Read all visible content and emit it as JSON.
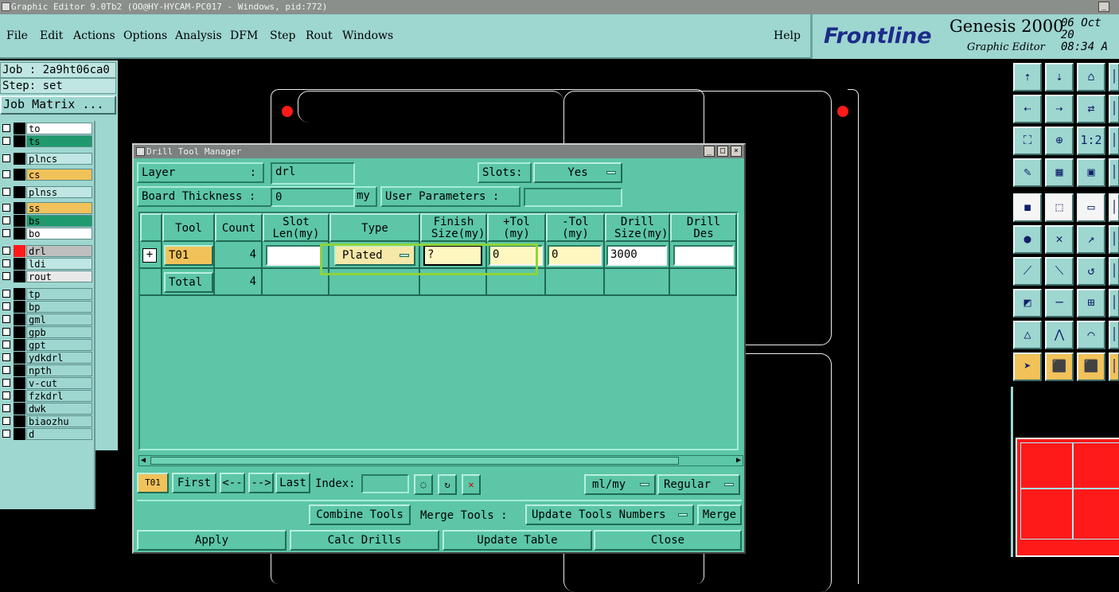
{
  "window": {
    "title": "Graphic Editor 9.0Tb2 (OO@HY-HYCAM-PC017 - Windows, pid:772)",
    "min_label": "_"
  },
  "menu": [
    "File",
    "Edit",
    "Actions",
    "Options",
    "Analysis",
    "DFM",
    "Step",
    "Rout",
    "Windows"
  ],
  "help_label": "Help",
  "brand": {
    "logo": "Frontline",
    "product": "Genesis 2000",
    "subtitle": "Graphic Editor",
    "date": "06 Oct 20",
    "time": "08:34 A"
  },
  "job": {
    "job_text": "Job : 2a9ht06ca0",
    "step_text": "Step: set",
    "matrix_label": "Job Matrix ..."
  },
  "layers": [
    {
      "name": "to",
      "color": "#ffffff"
    },
    {
      "name": "ts",
      "color": "#1f9a6e"
    },
    {
      "name": "plncs",
      "color": "#bfe6e2"
    },
    {
      "name": "cs",
      "color": "#f2c25a"
    },
    {
      "name": "plnss",
      "color": "#bfe6e2"
    },
    {
      "name": "ss",
      "color": "#f2c25a"
    },
    {
      "name": "bs",
      "color": "#1f9a6e"
    },
    {
      "name": "bo",
      "color": "#ffffff"
    },
    {
      "name": "drl",
      "color": "#bfbfbf"
    },
    {
      "name": "ldi",
      "color": "#bfe6e2"
    },
    {
      "name": "rout",
      "color": "#e8e8e8"
    },
    {
      "name": "tp",
      "color": "#9ed6d0"
    },
    {
      "name": "bp",
      "color": "#9ed6d0"
    },
    {
      "name": "gml",
      "color": "#9ed6d0"
    },
    {
      "name": "gpb",
      "color": "#9ed6d0"
    },
    {
      "name": "gpt",
      "color": "#9ed6d0"
    },
    {
      "name": "ydkdrl",
      "color": "#9ed6d0"
    },
    {
      "name": "npth",
      "color": "#9ed6d0"
    },
    {
      "name": "v-cut",
      "color": "#9ed6d0"
    },
    {
      "name": "fzkdrl",
      "color": "#9ed6d0"
    },
    {
      "name": "dwk",
      "color": "#9ed6d0"
    },
    {
      "name": "biaozhu",
      "color": "#9ed6d0"
    },
    {
      "name": "d",
      "color": "#9ed6d0"
    }
  ],
  "toolbox": {
    "icons": [
      "layer-up-icon",
      "layer-down-icon",
      "home-icon",
      "screen-edge-icon",
      "step-left-icon",
      "step-right-icon",
      "swap-icon",
      "more-icon",
      "fit-icon",
      "center-icon",
      "scale-icon",
      "more-icon",
      "tool-icon",
      "grid-icon",
      "traffic-light-icon",
      "more-icon",
      "record-icon",
      "shape-icon",
      "ruler-icon",
      "more-icon",
      "connect-icon",
      "cross-icon",
      "pick-icon",
      "more-icon",
      "angle-icon",
      "diagonal-icon",
      "rotate-icon",
      "more-icon",
      "pad-icon",
      "line-icon",
      "snap-icon",
      "more-icon",
      "triangle-icon",
      "triangle-outline-icon",
      "arc-icon",
      "more-icon",
      "select-icon",
      "select-box-icon",
      "select-area-icon",
      "more-icon"
    ],
    "scale_label": "1:2"
  },
  "dialog": {
    "title": "Drill Tool Manager",
    "layer_label": "Layer",
    "layer_colon": ":",
    "layer_value": "drl",
    "slots_label": "Slots:",
    "slots_value": "Yes",
    "board_thickness_label": "Board Thickness :",
    "board_thickness_value": "0",
    "board_thickness_unit": "my",
    "user_params_label": "User Parameters :",
    "user_params_value": "",
    "columns": [
      "Tool",
      "Count",
      "Slot Len(my)",
      "Type",
      "Finish Size(my)",
      "+Tol (my)",
      "-Tol (my)",
      "Drill Size(my)",
      "Drill Des"
    ],
    "row": {
      "tool": "T01",
      "count": "4",
      "slot_len": "",
      "type": "Plated",
      "finish_size": "?",
      "plus_tol": "0",
      "minus_tol": "0",
      "drill_size": "3000",
      "drill_des": ""
    },
    "total_label": "Total",
    "total_count": "4",
    "nav": {
      "current": "T01",
      "first": "First",
      "prev": "<--",
      "next": "-->",
      "last": "Last",
      "index_label": "Index:",
      "index_value": "",
      "units": "ml/my",
      "mode": "Regular"
    },
    "combine_tools": "Combine Tools",
    "merge_tools_label": "Merge Tools :",
    "update_tools_numbers": "Update Tools Numbers",
    "merge": "Merge",
    "apply": "Apply",
    "calc_drills": "Calc Drills",
    "update_table": "Update Table",
    "close": "Close"
  }
}
